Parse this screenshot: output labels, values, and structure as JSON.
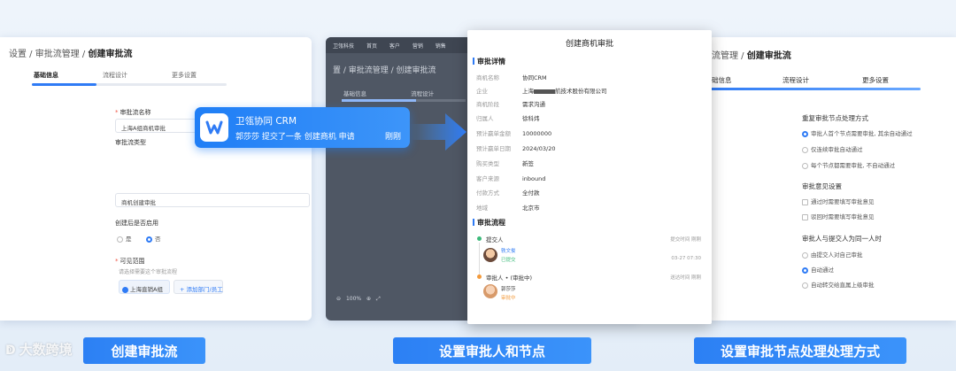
{
  "left": {
    "breadcrumb": "设置 / 审批流管理 / ",
    "breadcrumb_current": "创建审批流",
    "tabs": [
      "基础信息",
      "流程设计",
      "更多设置"
    ],
    "progress": 0.33,
    "fields": {
      "name_label": "审批流名称",
      "name_value": "上海A组商机审批",
      "type_label": "审批流类型",
      "type_value": "商机创建审批",
      "enable_label": "创建后是否启用",
      "enable_yes": "是",
      "enable_no": "否",
      "scope_label": "可见范围",
      "scope_hint": "请选择需要这个审批流程",
      "scope_tag": "上海直销A组",
      "scope_add": "+ 添加部门/员工"
    }
  },
  "notification": {
    "app": "卫瓴协同 CRM",
    "text": "郭莎莎 提交了一条 创建商机 申请",
    "time": "刚刚"
  },
  "middle": {
    "nav": [
      "卫瓴科技",
      "首页",
      "客户",
      "营销",
      "销售"
    ],
    "breadcrumb": "置 / 审批流管理 / 创建审批流",
    "tabs": [
      "基础信息",
      "流程设计"
    ],
    "zoom": "100%"
  },
  "detail": {
    "title": "创建商机审批",
    "section_detail": "审批详情",
    "rows": [
      {
        "k": "商机名称",
        "v": "协同CRM"
      },
      {
        "k": "企业",
        "v": "航技术股份有限公司",
        "prefix": "上海"
      },
      {
        "k": "商机阶段",
        "v": "需求沟通"
      },
      {
        "k": "归属人",
        "v": "徐科炜"
      },
      {
        "k": "预计赢单金额",
        "v": "10000000"
      },
      {
        "k": "预计赢单日期",
        "v": "2024/03/20"
      },
      {
        "k": "购买类型",
        "v": "新签"
      },
      {
        "k": "客户来源",
        "v": "inbound"
      },
      {
        "k": "付款方式",
        "v": "全付款"
      },
      {
        "k": "地域",
        "v": "北京市"
      }
    ],
    "section_flow": "审批流程",
    "flow": {
      "submitter_label": "提交人",
      "submitter_time_label": "提交时间 刚刚",
      "submitter_name": "轶文俊",
      "submitter_status": "已提交",
      "submitter_time": "03-27 07:30",
      "approver_label": "审批人 • (审批中)",
      "approver_time_label": "送达时间 刚刚",
      "approver_name": "郭莎莎",
      "approver_status": "审批中"
    }
  },
  "right": {
    "breadcrumb": "流管理 / ",
    "breadcrumb_current": "创建审批流",
    "tabs": [
      "础信息",
      "流程设计",
      "更多设置"
    ],
    "group1_title": "重复审批节点处理方式",
    "group1_opts": [
      "审批人首个节点需要审批, 其余自动通过",
      "仅连续审批自动通过",
      "每个节点都需要审批, 不自动通过"
    ],
    "group2_title": "审批意见设置",
    "group2_opts": [
      "通过时需要填写审批意见",
      "驳回时需要填写审批意见"
    ],
    "group3_title": "审批人与提交人为同一人时",
    "group3_opts": [
      "由提交人对自己审批",
      "自动通过",
      "自动转交给直属上级审批"
    ]
  },
  "captions": [
    "创建审批流",
    "设置审批人和节点",
    "设置审批节点处理处理方式"
  ],
  "watermark": "大数跨境",
  "colors": {
    "accent": "#2f7bf5",
    "caption_bg": "#2c80f4"
  }
}
